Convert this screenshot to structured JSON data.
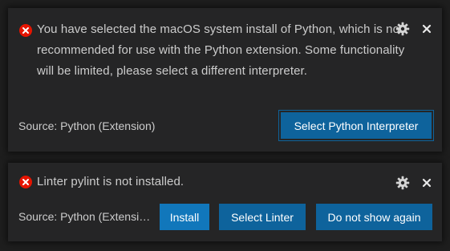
{
  "notifications": [
    {
      "severity": "error",
      "message": "You have selected the macOS system install of Python, which is not recommended for use with the Python extension. Some functionality will be limited, please select a different interpreter.",
      "source": "Source: Python (Extension)",
      "actions": [
        "Select Python Interpreter"
      ]
    },
    {
      "severity": "error",
      "message": "Linter pylint is not installed.",
      "source": "Source: Python (Extension)",
      "actions": [
        "Install",
        "Select Linter",
        "Do not show again"
      ]
    }
  ],
  "icons": {
    "error": "error-circle-x-icon",
    "settings": "gear-icon",
    "close": "close-icon"
  },
  "colors": {
    "error": "#e51400",
    "button": "#0e639c",
    "button_hover": "#1177bb",
    "toast_bg": "#252526",
    "text": "#cccccc"
  }
}
